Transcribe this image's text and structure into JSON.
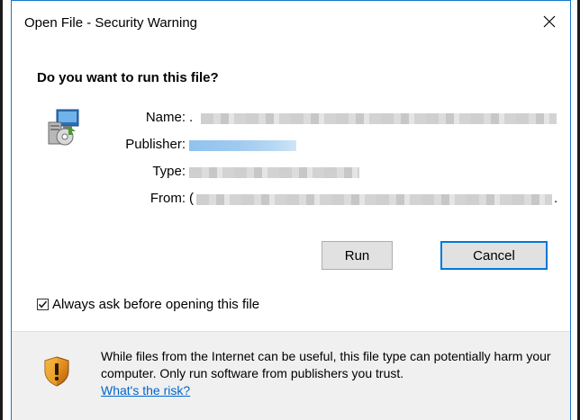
{
  "window": {
    "title": "Open File - Security Warning"
  },
  "question": "Do you want to run this file?",
  "fields": {
    "name_label": "Name:",
    "name_value": ".",
    "publisher_label": "Publisher:",
    "type_label": "Type:",
    "from_label": "From:",
    "from_value_start": "(",
    "from_value_end": "."
  },
  "buttons": {
    "run": "Run",
    "cancel": "Cancel"
  },
  "checkbox": {
    "label": "Always ask before opening this file",
    "checked": true
  },
  "footer": {
    "warning": "While files from the Internet can be useful, this file type can potentially harm your computer. Only run software from publishers you trust.",
    "link": "What's the risk?"
  },
  "icons": {
    "app": "installer-icon",
    "warning": "shield-warning-icon",
    "close": "close-icon",
    "check": "checkmark-icon"
  },
  "colors": {
    "accent": "#0078d7",
    "link": "#0066cc",
    "border": "#1979ca",
    "footer_bg": "#f0f0f0"
  }
}
